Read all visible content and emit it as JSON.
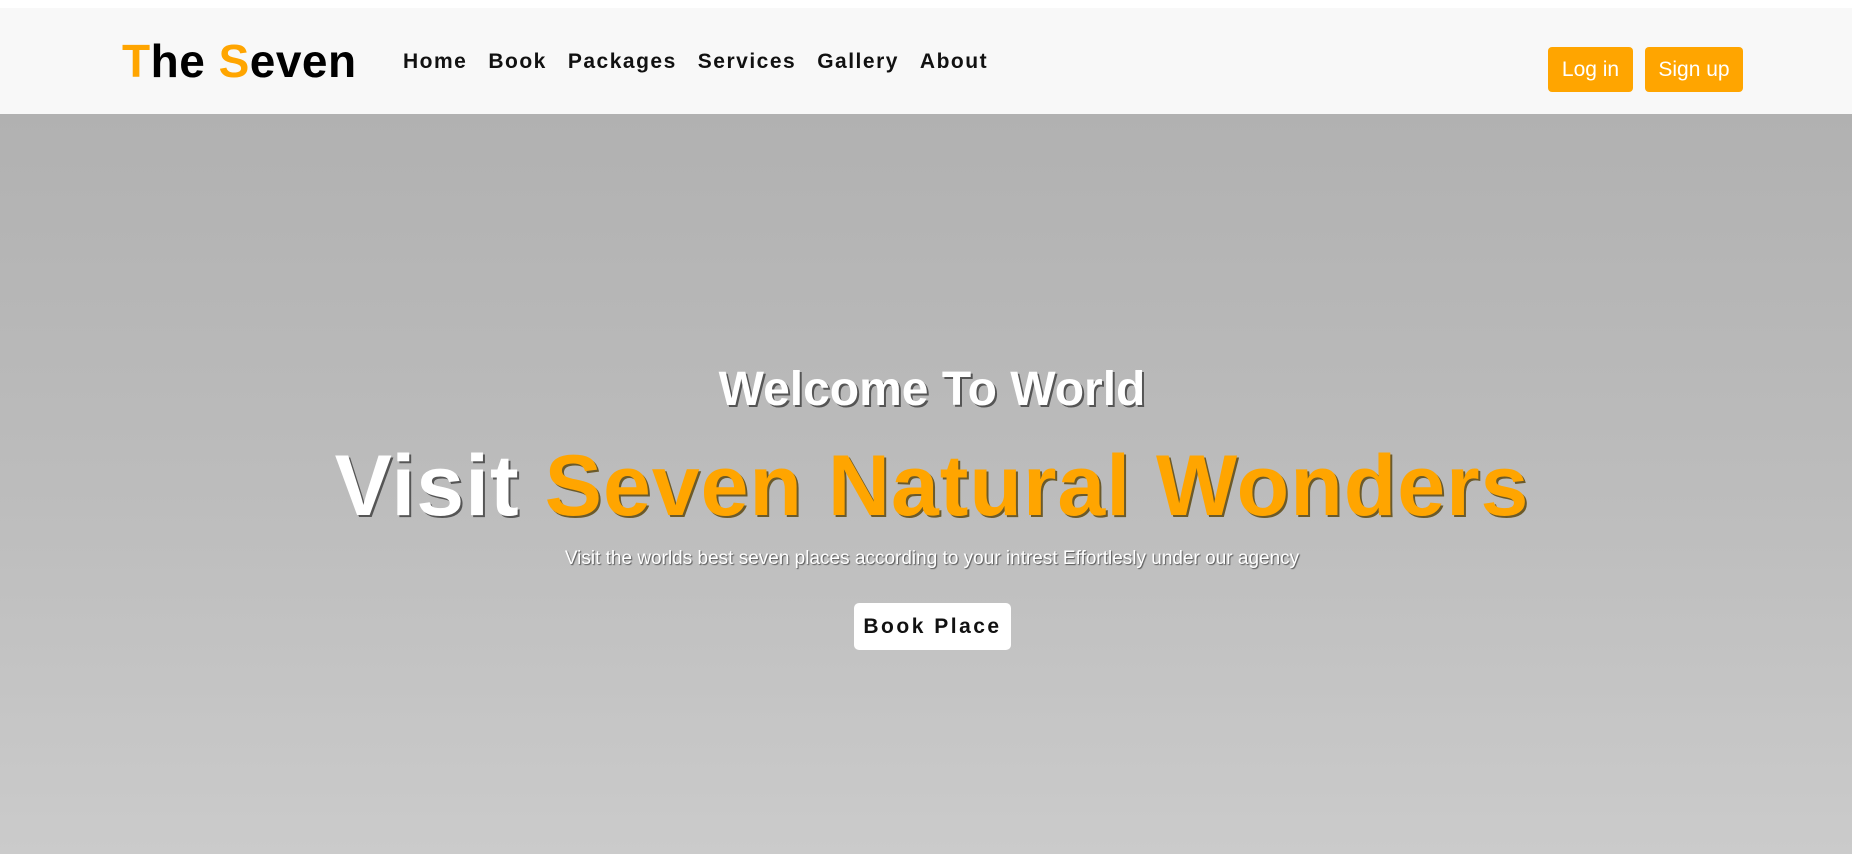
{
  "brand": {
    "logo_first_initial": "T",
    "logo_first_rest": "he",
    "logo_second_initial": "S",
    "logo_second_rest": "even",
    "accent_color": "#ffa500"
  },
  "nav": {
    "items": [
      {
        "label": "Home"
      },
      {
        "label": "Book"
      },
      {
        "label": "Packages"
      },
      {
        "label": "Services"
      },
      {
        "label": "Gallery"
      },
      {
        "label": "About"
      }
    ]
  },
  "auth": {
    "login_label": "Log in",
    "signup_label": "Sign up"
  },
  "hero": {
    "welcome": "Welcome To World",
    "title_plain": "Visit",
    "title_highlight": "Seven Natural Wonders",
    "subtitle": "Visit the worlds best seven places according to your intrest Effortlesly under our agency",
    "cta_label": "Book Place"
  }
}
